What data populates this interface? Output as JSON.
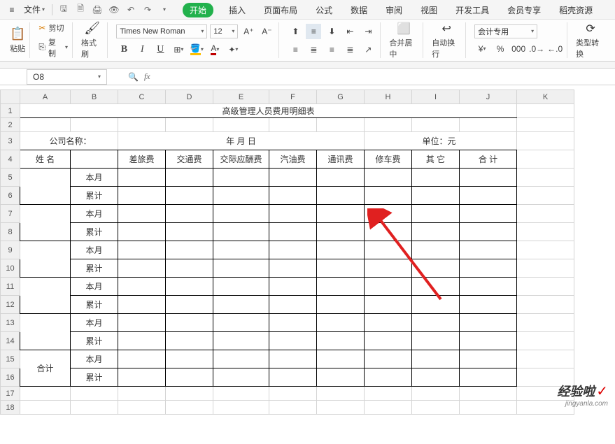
{
  "menu": {
    "file_label": "文件",
    "qat": [
      "save",
      "print",
      "preview",
      "undo",
      "redo"
    ]
  },
  "tabs": [
    "开始",
    "插入",
    "页面布局",
    "公式",
    "数据",
    "审阅",
    "视图",
    "开发工具",
    "会员专享",
    "稻壳资源"
  ],
  "active_tab": 0,
  "ribbon": {
    "paste_label": "粘贴",
    "cut_label": "剪切",
    "copy_label": "复制",
    "format_painter_label": "格式刷",
    "font_name": "Times New Roman",
    "font_size": "12",
    "bold": "B",
    "italic": "I",
    "underline": "U",
    "merge_label": "合并居中",
    "wrap_label": "自动换行",
    "number_format": "会计专用",
    "type_convert_label": "类型转换"
  },
  "name_box": "O8",
  "formula": "",
  "columns": [
    "A",
    "B",
    "C",
    "D",
    "E",
    "F",
    "G",
    "H",
    "I",
    "J",
    "K"
  ],
  "row_count": 18,
  "selected_row": 8,
  "title": "高级管理人员费用明细表",
  "row3": {
    "company_name": "公司名称：",
    "date": "年  月  日",
    "unit": "单位：元"
  },
  "headers": [
    "姓 名",
    "",
    "差旅费",
    "交通费",
    "交际应酬费",
    "汽油费",
    "通讯费",
    "修车费",
    "其 它",
    "合 计"
  ],
  "period": {
    "this_month": "本月",
    "cumulative": "累计"
  },
  "total_label": "合计",
  "watermark": {
    "main": "经验啦",
    "sub": "jingyanla.com"
  }
}
